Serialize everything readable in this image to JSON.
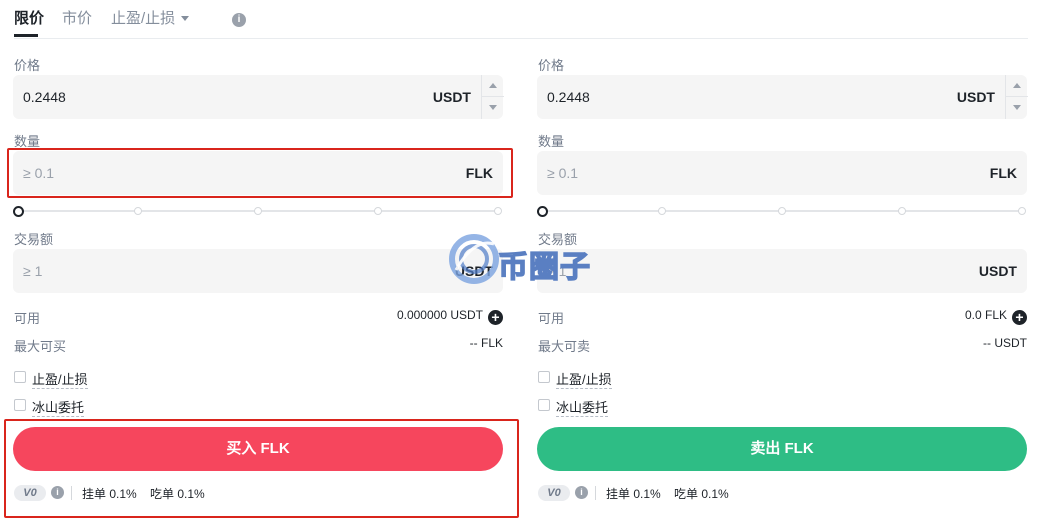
{
  "tabs": [
    {
      "label": "限价",
      "active": true
    },
    {
      "label": "市价",
      "active": false
    },
    {
      "label": "止盈/止损",
      "active": false,
      "has_dropdown": true
    }
  ],
  "tab_info_icon": "info-icon",
  "buy_panel": {
    "price_label": "价格",
    "price_value": "0.2448",
    "price_unit": "USDT",
    "amount_label": "数量",
    "amount_placeholder": "≥ 0.1",
    "amount_unit": "FLK",
    "slider_percent": 0,
    "total_label": "交易额",
    "total_placeholder": "≥ 1",
    "total_unit": "USDT",
    "available_label": "可用",
    "available_value": "0.000000 USDT",
    "max_label": "最大可买",
    "max_value": "-- FLK",
    "option_tpsl": "止盈/止损",
    "option_iceberg": "冰山委托",
    "submit_label": "买入 FLK",
    "vip_level": "V0",
    "maker_fee": "挂单 0.1%",
    "taker_fee": "吃单 0.1%"
  },
  "sell_panel": {
    "price_label": "价格",
    "price_value": "0.2448",
    "price_unit": "USDT",
    "amount_label": "数量",
    "amount_placeholder": "≥ 0.1",
    "amount_unit": "FLK",
    "slider_percent": 0,
    "total_label": "交易额",
    "total_placeholder": "≥ 1",
    "total_unit": "USDT",
    "available_label": "可用",
    "available_value": "0.0 FLK",
    "max_label": "最大可卖",
    "max_value": "-- USDT",
    "option_tpsl": "止盈/止损",
    "option_iceberg": "冰山委托",
    "submit_label": "卖出 FLK",
    "vip_level": "V0",
    "maker_fee": "挂单 0.1%",
    "taker_fee": "吃单 0.1%"
  },
  "watermark_text": "币圈子",
  "colors": {
    "buy": "#f6465d",
    "sell": "#2ebd85",
    "highlight": "#d9251c",
    "text": "#1e2329",
    "muted": "#707a8a"
  }
}
